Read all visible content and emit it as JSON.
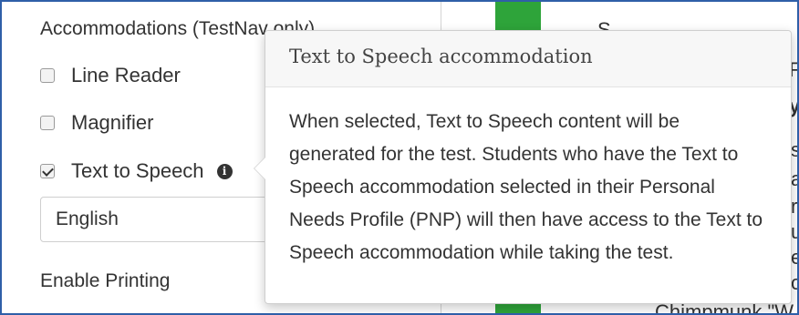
{
  "left": {
    "section_title": "Accommodations (TestNav only)",
    "options": [
      {
        "label": "Line Reader",
        "checked": false
      },
      {
        "label": "Magnifier",
        "checked": false
      },
      {
        "label": "Text to Speech",
        "checked": true
      }
    ],
    "language_select": {
      "value": "English"
    },
    "enable_printing_label": "Enable Printing"
  },
  "right": {
    "partial_words": [
      "S",
      "F",
      "y",
      "s",
      "a",
      "r",
      "u",
      "e",
      "o",
      "Chimpmunk \"W"
    ]
  },
  "popover": {
    "title": "Text to Speech accommodation",
    "body": "When selected, Text to Speech content will be generated for the test. Students who have the Text to Speech accommodation selected in their Personal Needs Profile (PNP) will then have access to the Text to Speech accommodation while taking the test."
  },
  "colors": {
    "accent_green": "#2ea43a",
    "frame_border": "#2f5fa8"
  }
}
